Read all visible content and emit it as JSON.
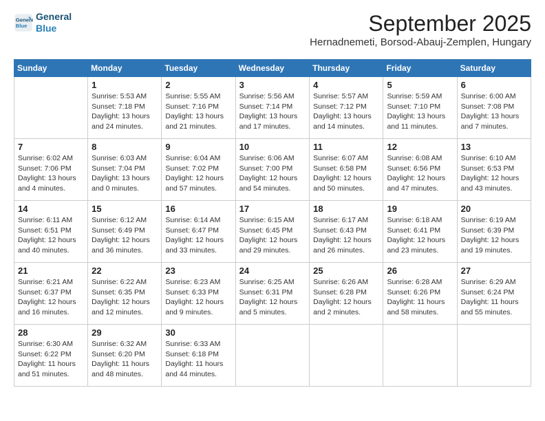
{
  "logo": {
    "line1": "General",
    "line2": "Blue"
  },
  "title": "September 2025",
  "location": "Hernadnemeti, Borsod-Abauj-Zemplen, Hungary",
  "days_of_week": [
    "Sunday",
    "Monday",
    "Tuesday",
    "Wednesday",
    "Thursday",
    "Friday",
    "Saturday"
  ],
  "weeks": [
    [
      {
        "day": "",
        "info": ""
      },
      {
        "day": "1",
        "info": "Sunrise: 5:53 AM\nSunset: 7:18 PM\nDaylight: 13 hours\nand 24 minutes."
      },
      {
        "day": "2",
        "info": "Sunrise: 5:55 AM\nSunset: 7:16 PM\nDaylight: 13 hours\nand 21 minutes."
      },
      {
        "day": "3",
        "info": "Sunrise: 5:56 AM\nSunset: 7:14 PM\nDaylight: 13 hours\nand 17 minutes."
      },
      {
        "day": "4",
        "info": "Sunrise: 5:57 AM\nSunset: 7:12 PM\nDaylight: 13 hours\nand 14 minutes."
      },
      {
        "day": "5",
        "info": "Sunrise: 5:59 AM\nSunset: 7:10 PM\nDaylight: 13 hours\nand 11 minutes."
      },
      {
        "day": "6",
        "info": "Sunrise: 6:00 AM\nSunset: 7:08 PM\nDaylight: 13 hours\nand 7 minutes."
      }
    ],
    [
      {
        "day": "7",
        "info": "Sunrise: 6:02 AM\nSunset: 7:06 PM\nDaylight: 13 hours\nand 4 minutes."
      },
      {
        "day": "8",
        "info": "Sunrise: 6:03 AM\nSunset: 7:04 PM\nDaylight: 13 hours\nand 0 minutes."
      },
      {
        "day": "9",
        "info": "Sunrise: 6:04 AM\nSunset: 7:02 PM\nDaylight: 12 hours\nand 57 minutes."
      },
      {
        "day": "10",
        "info": "Sunrise: 6:06 AM\nSunset: 7:00 PM\nDaylight: 12 hours\nand 54 minutes."
      },
      {
        "day": "11",
        "info": "Sunrise: 6:07 AM\nSunset: 6:58 PM\nDaylight: 12 hours\nand 50 minutes."
      },
      {
        "day": "12",
        "info": "Sunrise: 6:08 AM\nSunset: 6:56 PM\nDaylight: 12 hours\nand 47 minutes."
      },
      {
        "day": "13",
        "info": "Sunrise: 6:10 AM\nSunset: 6:53 PM\nDaylight: 12 hours\nand 43 minutes."
      }
    ],
    [
      {
        "day": "14",
        "info": "Sunrise: 6:11 AM\nSunset: 6:51 PM\nDaylight: 12 hours\nand 40 minutes."
      },
      {
        "day": "15",
        "info": "Sunrise: 6:12 AM\nSunset: 6:49 PM\nDaylight: 12 hours\nand 36 minutes."
      },
      {
        "day": "16",
        "info": "Sunrise: 6:14 AM\nSunset: 6:47 PM\nDaylight: 12 hours\nand 33 minutes."
      },
      {
        "day": "17",
        "info": "Sunrise: 6:15 AM\nSunset: 6:45 PM\nDaylight: 12 hours\nand 29 minutes."
      },
      {
        "day": "18",
        "info": "Sunrise: 6:17 AM\nSunset: 6:43 PM\nDaylight: 12 hours\nand 26 minutes."
      },
      {
        "day": "19",
        "info": "Sunrise: 6:18 AM\nSunset: 6:41 PM\nDaylight: 12 hours\nand 23 minutes."
      },
      {
        "day": "20",
        "info": "Sunrise: 6:19 AM\nSunset: 6:39 PM\nDaylight: 12 hours\nand 19 minutes."
      }
    ],
    [
      {
        "day": "21",
        "info": "Sunrise: 6:21 AM\nSunset: 6:37 PM\nDaylight: 12 hours\nand 16 minutes."
      },
      {
        "day": "22",
        "info": "Sunrise: 6:22 AM\nSunset: 6:35 PM\nDaylight: 12 hours\nand 12 minutes."
      },
      {
        "day": "23",
        "info": "Sunrise: 6:23 AM\nSunset: 6:33 PM\nDaylight: 12 hours\nand 9 minutes."
      },
      {
        "day": "24",
        "info": "Sunrise: 6:25 AM\nSunset: 6:31 PM\nDaylight: 12 hours\nand 5 minutes."
      },
      {
        "day": "25",
        "info": "Sunrise: 6:26 AM\nSunset: 6:28 PM\nDaylight: 12 hours\nand 2 minutes."
      },
      {
        "day": "26",
        "info": "Sunrise: 6:28 AM\nSunset: 6:26 PM\nDaylight: 11 hours\nand 58 minutes."
      },
      {
        "day": "27",
        "info": "Sunrise: 6:29 AM\nSunset: 6:24 PM\nDaylight: 11 hours\nand 55 minutes."
      }
    ],
    [
      {
        "day": "28",
        "info": "Sunrise: 6:30 AM\nSunset: 6:22 PM\nDaylight: 11 hours\nand 51 minutes."
      },
      {
        "day": "29",
        "info": "Sunrise: 6:32 AM\nSunset: 6:20 PM\nDaylight: 11 hours\nand 48 minutes."
      },
      {
        "day": "30",
        "info": "Sunrise: 6:33 AM\nSunset: 6:18 PM\nDaylight: 11 hours\nand 44 minutes."
      },
      {
        "day": "",
        "info": ""
      },
      {
        "day": "",
        "info": ""
      },
      {
        "day": "",
        "info": ""
      },
      {
        "day": "",
        "info": ""
      }
    ]
  ]
}
